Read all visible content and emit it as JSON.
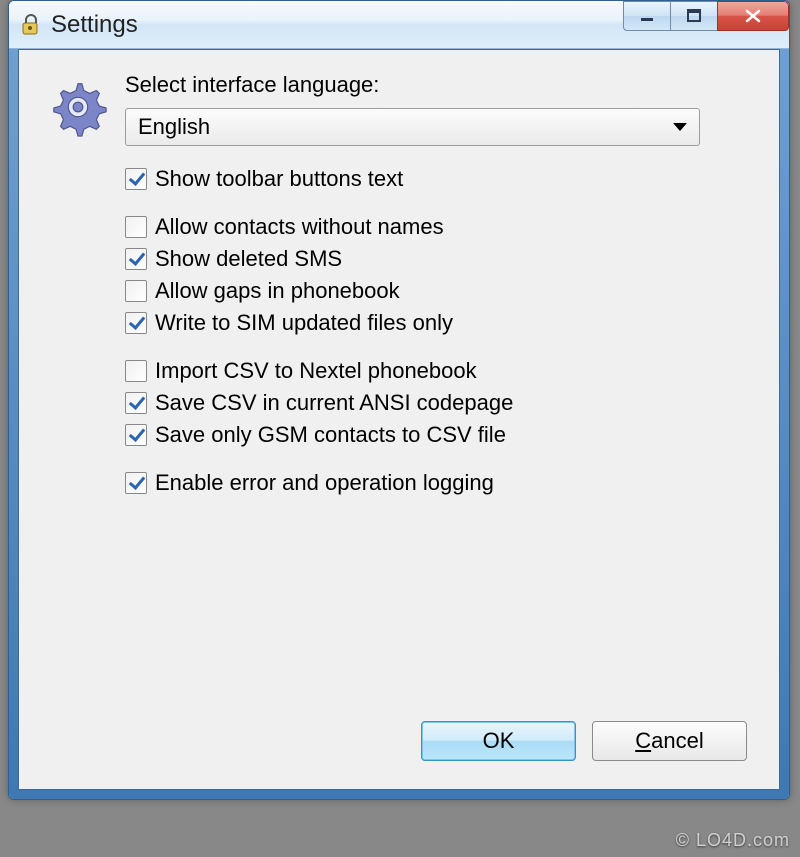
{
  "window": {
    "title": "Settings"
  },
  "language": {
    "label": "Select interface language:",
    "value": "English"
  },
  "groups": [
    {
      "items": [
        {
          "label": "Show toolbar buttons text",
          "checked": true
        }
      ]
    },
    {
      "items": [
        {
          "label": "Allow contacts without names",
          "checked": false
        },
        {
          "label": "Show deleted SMS",
          "checked": true
        },
        {
          "label": "Allow gaps in phonebook",
          "checked": false
        },
        {
          "label": "Write to SIM updated files only",
          "checked": true
        }
      ]
    },
    {
      "items": [
        {
          "label": "Import CSV to Nextel phonebook",
          "checked": false
        },
        {
          "label": "Save CSV in current ANSI codepage",
          "checked": true
        },
        {
          "label": "Save only GSM contacts to CSV file",
          "checked": true
        }
      ]
    },
    {
      "items": [
        {
          "label": "Enable error and operation logging",
          "checked": true
        }
      ]
    }
  ],
  "buttons": {
    "ok": "OK",
    "cancel": "Cancel"
  },
  "watermark": "© LO4D.com"
}
